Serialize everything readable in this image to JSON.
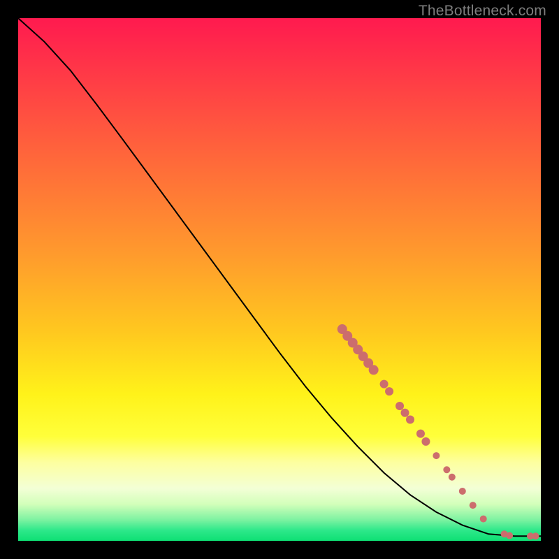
{
  "attribution": "TheBottleneck.com",
  "colors": {
    "marker": "#cc6d6d",
    "curve": "#000000",
    "bg_black": "#000000"
  },
  "chart_data": {
    "type": "line",
    "title": "",
    "xlabel": "",
    "ylabel": "",
    "xlim": [
      0,
      100
    ],
    "ylim": [
      0,
      100
    ],
    "curve": [
      {
        "x": 0,
        "y": 100
      },
      {
        "x": 5,
        "y": 95.5
      },
      {
        "x": 10,
        "y": 90
      },
      {
        "x": 15,
        "y": 83.5
      },
      {
        "x": 20,
        "y": 76.8
      },
      {
        "x": 25,
        "y": 70
      },
      {
        "x": 30,
        "y": 63.2
      },
      {
        "x": 35,
        "y": 56.4
      },
      {
        "x": 40,
        "y": 49.6
      },
      {
        "x": 45,
        "y": 42.8
      },
      {
        "x": 50,
        "y": 36.0
      },
      {
        "x": 55,
        "y": 29.5
      },
      {
        "x": 60,
        "y": 23.5
      },
      {
        "x": 65,
        "y": 18.0
      },
      {
        "x": 70,
        "y": 13.0
      },
      {
        "x": 75,
        "y": 8.8
      },
      {
        "x": 80,
        "y": 5.5
      },
      {
        "x": 85,
        "y": 3.0
      },
      {
        "x": 90,
        "y": 1.3
      },
      {
        "x": 95,
        "y": 0.9
      },
      {
        "x": 100,
        "y": 0.9
      }
    ],
    "markers": [
      {
        "x": 62,
        "y": 40.5,
        "r": 7
      },
      {
        "x": 63,
        "y": 39.2,
        "r": 7
      },
      {
        "x": 64,
        "y": 37.9,
        "r": 7
      },
      {
        "x": 65,
        "y": 36.6,
        "r": 7
      },
      {
        "x": 66,
        "y": 35.3,
        "r": 7
      },
      {
        "x": 67,
        "y": 34.0,
        "r": 7
      },
      {
        "x": 68,
        "y": 32.7,
        "r": 7
      },
      {
        "x": 70,
        "y": 30.0,
        "r": 6
      },
      {
        "x": 71,
        "y": 28.6,
        "r": 6
      },
      {
        "x": 73,
        "y": 25.8,
        "r": 6
      },
      {
        "x": 74,
        "y": 24.5,
        "r": 6
      },
      {
        "x": 75,
        "y": 23.2,
        "r": 6
      },
      {
        "x": 77,
        "y": 20.5,
        "r": 6
      },
      {
        "x": 78,
        "y": 19.0,
        "r": 6
      },
      {
        "x": 80,
        "y": 16.3,
        "r": 5
      },
      {
        "x": 82,
        "y": 13.6,
        "r": 5
      },
      {
        "x": 83,
        "y": 12.2,
        "r": 5
      },
      {
        "x": 85,
        "y": 9.5,
        "r": 5
      },
      {
        "x": 87,
        "y": 6.8,
        "r": 5
      },
      {
        "x": 89,
        "y": 4.2,
        "r": 5
      },
      {
        "x": 93,
        "y": 1.3,
        "r": 5
      },
      {
        "x": 94,
        "y": 1.0,
        "r": 5
      },
      {
        "x": 98,
        "y": 0.9,
        "r": 5
      },
      {
        "x": 99,
        "y": 0.9,
        "r": 5
      }
    ],
    "gradient_stops": [
      {
        "pct": 0,
        "color": "#ff1a4f"
      },
      {
        "pct": 22,
        "color": "#ff5a3e"
      },
      {
        "pct": 45,
        "color": "#ff9a2d"
      },
      {
        "pct": 60,
        "color": "#ffc81f"
      },
      {
        "pct": 72,
        "color": "#fff21a"
      },
      {
        "pct": 80,
        "color": "#ffff3a"
      },
      {
        "pct": 85,
        "color": "#fdffa0"
      },
      {
        "pct": 90,
        "color": "#f3ffd6"
      },
      {
        "pct": 93,
        "color": "#d2ffba"
      },
      {
        "pct": 96,
        "color": "#7cf2a1"
      },
      {
        "pct": 98,
        "color": "#2de88a"
      },
      {
        "pct": 100,
        "color": "#0ee074"
      }
    ]
  }
}
